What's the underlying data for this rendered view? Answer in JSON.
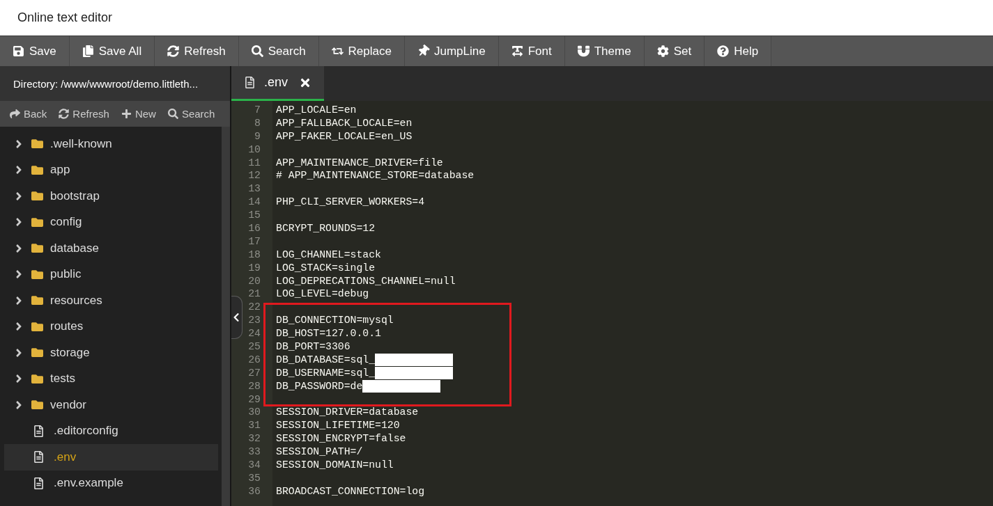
{
  "window": {
    "title": "Online text editor"
  },
  "toolbar": [
    "Save",
    "Save All",
    "Refresh",
    "Search",
    "Replace",
    "JumpLine",
    "Font",
    "Theme",
    "Set",
    "Help"
  ],
  "sidebar": {
    "directory": "Directory: /www/wwwroot/demo.littleth...",
    "actions": [
      "Back",
      "Refresh",
      "New",
      "Search"
    ],
    "items": [
      {
        "kind": "folder",
        "name": ".well-known",
        "expanded": false,
        "selected": false
      },
      {
        "kind": "folder",
        "name": "app",
        "expanded": false,
        "selected": false
      },
      {
        "kind": "folder",
        "name": "bootstrap",
        "expanded": false,
        "selected": false
      },
      {
        "kind": "folder",
        "name": "config",
        "expanded": false,
        "selected": false
      },
      {
        "kind": "folder",
        "name": "database",
        "expanded": false,
        "selected": false
      },
      {
        "kind": "folder",
        "name": "public",
        "expanded": false,
        "selected": false
      },
      {
        "kind": "folder",
        "name": "resources",
        "expanded": false,
        "selected": false
      },
      {
        "kind": "folder",
        "name": "routes",
        "expanded": false,
        "selected": false
      },
      {
        "kind": "folder",
        "name": "storage",
        "expanded": false,
        "selected": false
      },
      {
        "kind": "folder",
        "name": "tests",
        "expanded": false,
        "selected": false
      },
      {
        "kind": "folder",
        "name": "vendor",
        "expanded": false,
        "selected": false
      },
      {
        "kind": "file",
        "name": ".editorconfig",
        "selected": false
      },
      {
        "kind": "file",
        "name": ".env",
        "selected": true
      },
      {
        "kind": "file",
        "name": ".env.example",
        "selected": false
      }
    ]
  },
  "editor": {
    "tabs": [
      {
        "label": ".env",
        "selected": true
      }
    ],
    "sections": [
      {
        "outlined": false,
        "lines": [
          {
            "number": "7",
            "text": "APP_LOCALE=en",
            "redacted": false
          },
          {
            "number": "8",
            "text": "APP_FALLBACK_LOCALE=en",
            "redacted": false
          },
          {
            "number": "9",
            "text": "APP_FAKER_LOCALE=en_US",
            "redacted": false
          },
          {
            "number": "10",
            "redacted": false
          },
          {
            "number": "11",
            "text": "APP_MAINTENANCE_DRIVER=file",
            "redacted": false
          },
          {
            "number": "12",
            "text": "# APP_MAINTENANCE_STORE=database",
            "redacted": false
          },
          {
            "number": "13",
            "redacted": false
          },
          {
            "number": "14",
            "text": "PHP_CLI_SERVER_WORKERS=4",
            "redacted": false
          },
          {
            "number": "15",
            "redacted": false
          },
          {
            "number": "16",
            "text": "BCRYPT_ROUNDS=12",
            "redacted": false
          },
          {
            "number": "17",
            "redacted": false
          },
          {
            "number": "18",
            "text": "LOG_CHANNEL=stack",
            "redacted": false
          },
          {
            "number": "19",
            "text": "LOG_STACK=single",
            "redacted": false
          },
          {
            "number": "20",
            "text": "LOG_DEPRECATIONS_CHANNEL=null",
            "redacted": false
          },
          {
            "number": "21",
            "text": "LOG_LEVEL=debug",
            "redacted": false
          }
        ]
      },
      {
        "outlined": true,
        "lines": [
          {
            "number": "22",
            "redacted": false
          },
          {
            "number": "23",
            "text": "DB_CONNECTION=mysql",
            "redacted": false
          },
          {
            "number": "24",
            "text": "DB_HOST=127.0.0.1",
            "redacted": false
          },
          {
            "number": "25",
            "text": "DB_PORT=3306",
            "redacted": false
          },
          {
            "number": "26",
            "text": "DB_DATABASE=sql_",
            "redacted": true
          },
          {
            "number": "27",
            "text": "DB_USERNAME=sql_",
            "redacted": true
          },
          {
            "number": "28",
            "text": "DB_PASSWORD=de",
            "redacted": true
          },
          {
            "number": "29",
            "redacted": false
          }
        ]
      },
      {
        "outlined": false,
        "lines": [
          {
            "number": "30",
            "text": "SESSION_DRIVER=database",
            "redacted": false
          },
          {
            "number": "31",
            "text": "SESSION_LIFETIME=120",
            "redacted": false
          },
          {
            "number": "32",
            "text": "SESSION_ENCRYPT=false",
            "redacted": false
          },
          {
            "number": "33",
            "text": "SESSION_PATH=/",
            "redacted": false
          },
          {
            "number": "34",
            "text": "SESSION_DOMAIN=null",
            "redacted": false
          },
          {
            "number": "35",
            "redacted": false
          },
          {
            "number": "36",
            "text": "BROADCAST_CONNECTION=log",
            "redacted": false
          }
        ]
      }
    ]
  }
}
